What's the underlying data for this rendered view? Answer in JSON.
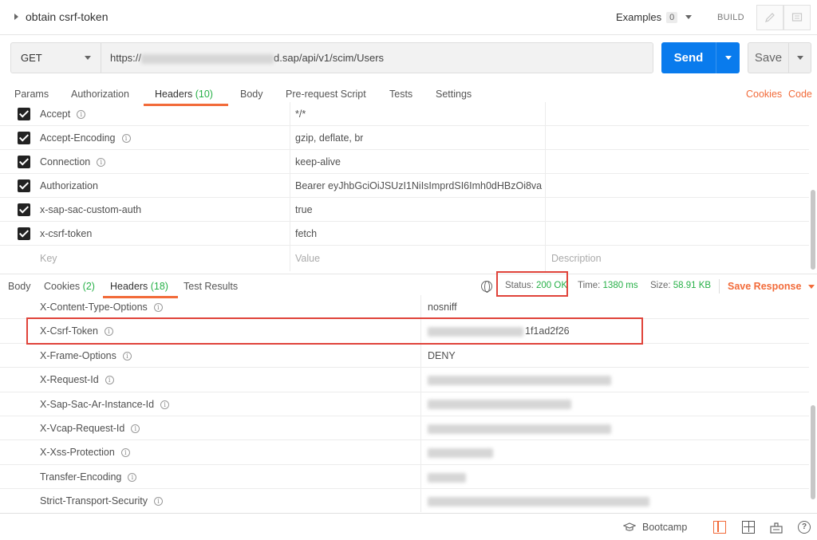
{
  "header": {
    "request_name": "obtain csrf-token",
    "examples_label": "Examples",
    "examples_count": "0",
    "build_label": "BUILD"
  },
  "request": {
    "method": "GET",
    "url_prefix": "https://",
    "url_suffix": "d.sap/api/v1/scim/Users",
    "send_label": "Send",
    "save_label": "Save"
  },
  "request_tabs": {
    "params": "Params",
    "authorization": "Authorization",
    "headers": "Headers",
    "headers_count": "(10)",
    "body": "Body",
    "pre_request": "Pre-request Script",
    "tests": "Tests",
    "settings": "Settings",
    "cookies": "Cookies",
    "code": "Code"
  },
  "request_headers": [
    {
      "key": "Accept",
      "value": "*/*"
    },
    {
      "key": "Accept-Encoding",
      "value": "gzip, deflate, br"
    },
    {
      "key": "Connection",
      "value": "keep-alive"
    },
    {
      "key": "Authorization",
      "value": "Bearer eyJhbGciOiJSUzI1NiIsImprdSI6Imh0dHBzOi8va..."
    },
    {
      "key": "x-sap-sac-custom-auth",
      "value": "true"
    },
    {
      "key": "x-csrf-token",
      "value": "fetch"
    }
  ],
  "request_placeholders": {
    "key": "Key",
    "value": "Value",
    "description": "Description"
  },
  "response_tabs": {
    "body": "Body",
    "cookies": "Cookies",
    "cookies_count": "(2)",
    "headers": "Headers",
    "headers_count": "(18)",
    "test_results": "Test Results"
  },
  "response_status": {
    "status_label": "Status:",
    "status_value": "200 OK",
    "time_label": "Time:",
    "time_value": "1380 ms",
    "size_label": "Size:",
    "size_value": "58.91 KB",
    "save_response": "Save Response"
  },
  "response_headers": [
    {
      "key": "X-Content-Type-Options",
      "value": "nosniff"
    },
    {
      "key": "X-Csrf-Token",
      "value": "1f1ad2f26"
    },
    {
      "key": "X-Frame-Options",
      "value": "DENY"
    },
    {
      "key": "X-Request-Id",
      "value": ""
    },
    {
      "key": "X-Sap-Sac-Ar-Instance-Id",
      "value": ""
    },
    {
      "key": "X-Vcap-Request-Id",
      "value": ""
    },
    {
      "key": "X-Xss-Protection",
      "value": ""
    },
    {
      "key": "Transfer-Encoding",
      "value": ""
    },
    {
      "key": "Strict-Transport-Security",
      "value": ""
    }
  ],
  "footer": {
    "bootcamp_label": "Bootcamp"
  },
  "colors": {
    "accent": "#f26b3a",
    "send_blue": "#097bed",
    "success_green": "#26b047",
    "highlight_red": "#e0433a"
  },
  "icons": {
    "title_caret": "caret-right-icon",
    "pencil": "pencil-icon",
    "comment": "comment-icon",
    "info": "info-icon",
    "globe": "globe-icon",
    "bootcamp": "graduation-cap-icon",
    "two_pane": "two-pane-icon",
    "grid": "grid-layout-icon",
    "keyboard": "keyboard-icon",
    "help": "help-icon"
  }
}
